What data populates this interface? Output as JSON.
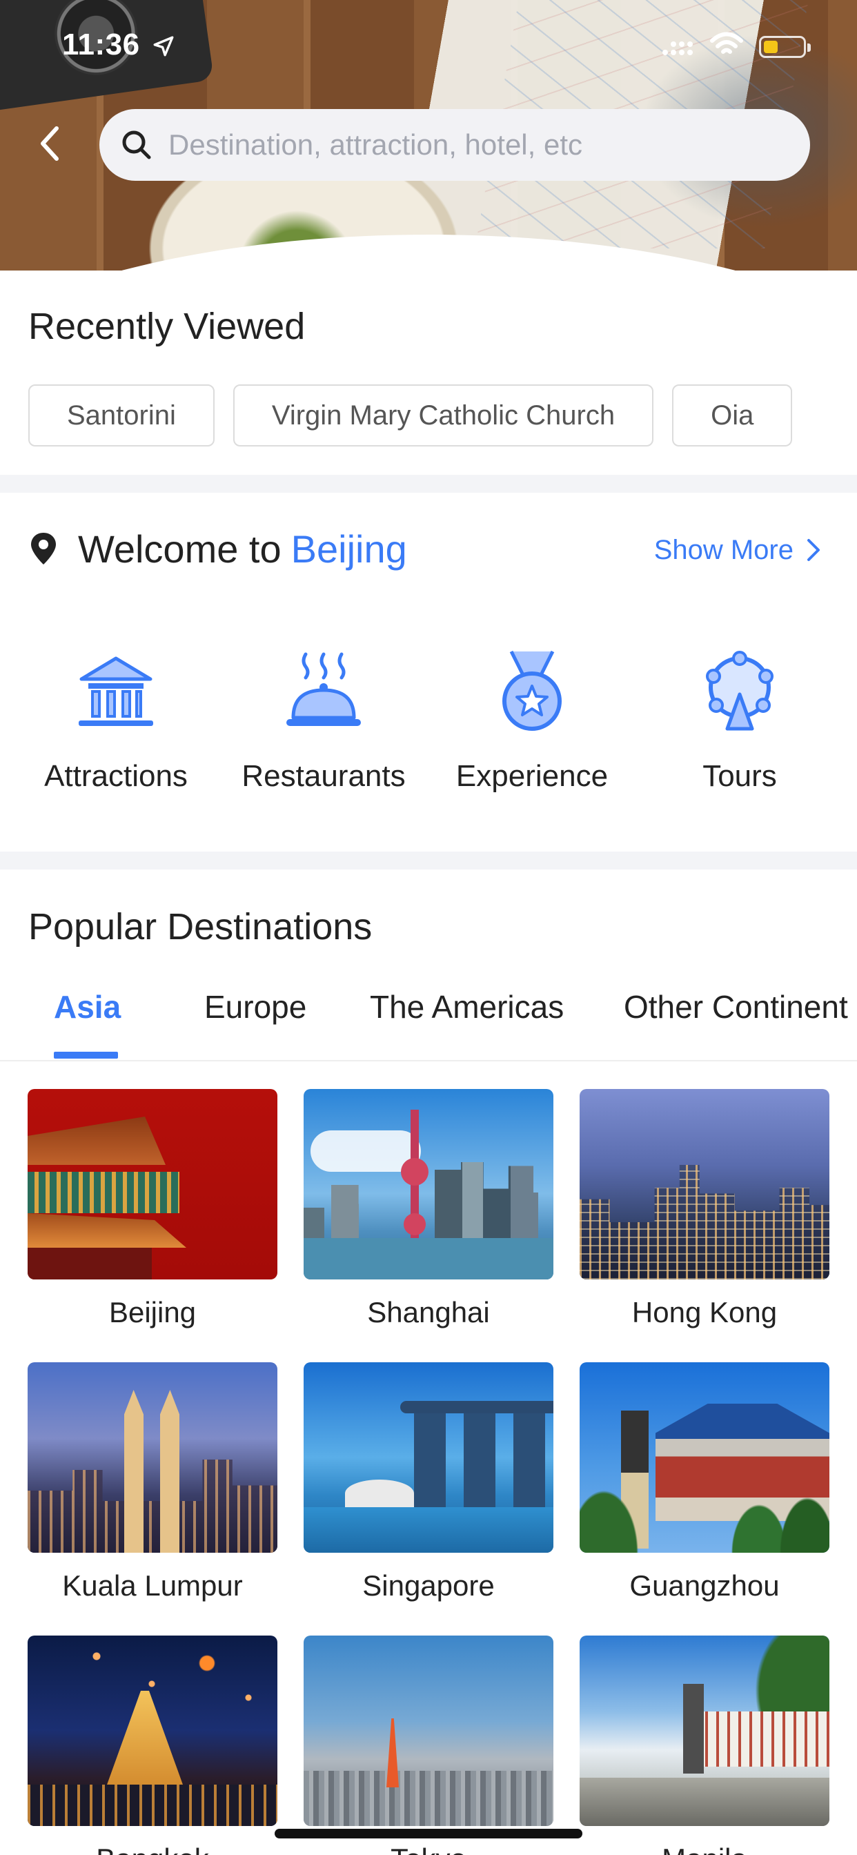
{
  "status_bar": {
    "time": "11:36"
  },
  "search": {
    "placeholder": "Destination, attraction, hotel, etc"
  },
  "recently_viewed": {
    "title": "Recently Viewed",
    "items": [
      "Santorini",
      "Virgin Mary Catholic Church",
      "Oia"
    ]
  },
  "welcome": {
    "prefix": "Welcome to",
    "city": "Beijing",
    "show_more": "Show More"
  },
  "categories": [
    {
      "label": "Attractions",
      "icon": "museum-icon"
    },
    {
      "label": "Restaurants",
      "icon": "cloche-icon"
    },
    {
      "label": "Experience",
      "icon": "medal-icon"
    },
    {
      "label": "Tours",
      "icon": "ferris-wheel-icon"
    }
  ],
  "popular": {
    "title": "Popular Destinations",
    "tabs": [
      "Asia",
      "Europe",
      "The Americas",
      "Other Continent"
    ],
    "active_tab": "Asia",
    "destinations": [
      "Beijing",
      "Shanghai",
      "Hong Kong",
      "Kuala Lumpur",
      "Singapore",
      "Guangzhou",
      "Bangkok",
      "Tokyo",
      "Manila"
    ]
  },
  "colors": {
    "accent": "#3a7bf6",
    "icon_fill": "#8fb4ff",
    "divider": "#f3f4f7"
  }
}
